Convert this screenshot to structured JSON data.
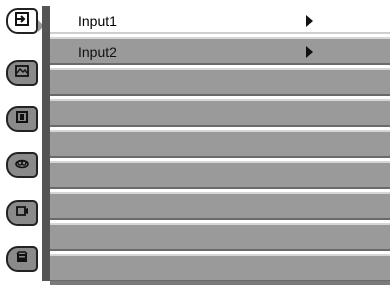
{
  "menu": {
    "rows": [
      {
        "label": "Input1",
        "has_submenu": true,
        "selected": true
      },
      {
        "label": "Input2",
        "has_submenu": true,
        "selected": false
      },
      {
        "label": "",
        "has_submenu": false,
        "selected": false
      },
      {
        "label": "",
        "has_submenu": false,
        "selected": false
      },
      {
        "label": "",
        "has_submenu": false,
        "selected": false
      },
      {
        "label": "",
        "has_submenu": false,
        "selected": false
      },
      {
        "label": "",
        "has_submenu": false,
        "selected": false
      },
      {
        "label": "",
        "has_submenu": false,
        "selected": false
      },
      {
        "label": "",
        "has_submenu": false,
        "selected": false
      }
    ]
  },
  "sidebar": {
    "items": [
      {
        "icon": "input-icon",
        "active": true
      },
      {
        "icon": "image-adjust-icon",
        "active": false
      },
      {
        "icon": "screen-icon",
        "active": false
      },
      {
        "icon": "setting-icon",
        "active": false
      },
      {
        "icon": "sound-icon",
        "active": false
      },
      {
        "icon": "info-icon",
        "active": false
      }
    ]
  },
  "colors": {
    "row_bg": "#9a9a9a",
    "row_active_bg": "#ffffff",
    "rail_button_bg": "#8a8a8a"
  }
}
